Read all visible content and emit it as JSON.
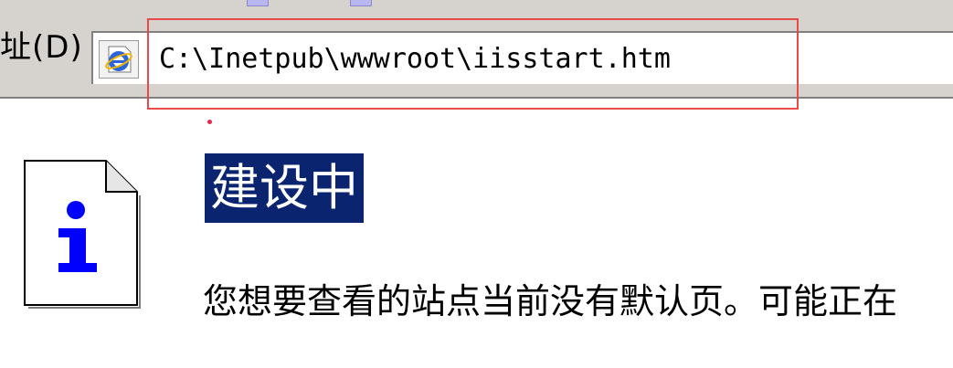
{
  "browser": {
    "address_label": "址(D)",
    "address_url": "C:\\Inetpub\\wwwroot\\iisstart.htm",
    "page_icon": "ie-page-icon"
  },
  "page": {
    "icon": "info-icon",
    "title": "建设中",
    "message": "您想要查看的站点当前没有默认页。可能正在"
  },
  "colors": {
    "highlight_border": "#e84a4a",
    "title_background": "#0a2470",
    "info_blue": "#0000ff"
  }
}
